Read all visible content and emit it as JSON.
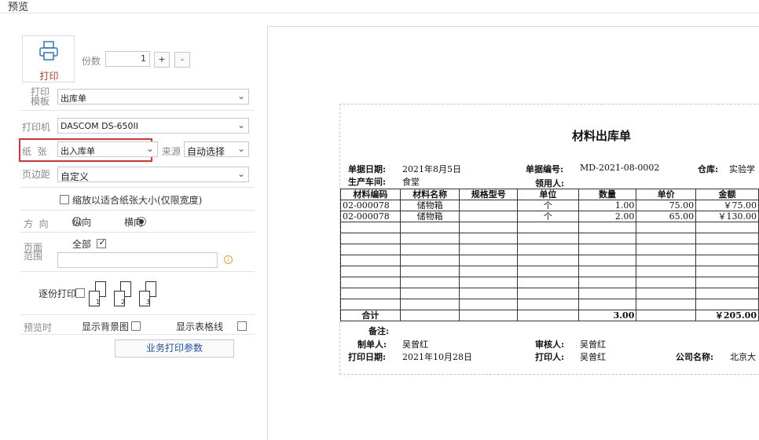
{
  "window": {
    "title": "预览"
  },
  "print_button": {
    "label": "打印",
    "icon": "printer-icon"
  },
  "copies": {
    "label": "份数",
    "value": "1",
    "plus": "+",
    "minus": "-"
  },
  "template": {
    "label_line1": "打印",
    "label_line2": "模板",
    "value": "出库单"
  },
  "printer": {
    "label": "打印机",
    "value": "DASCOM DS-650II"
  },
  "paper": {
    "label": "纸  张",
    "value": "出入库单",
    "source_label": "来源",
    "source_value": "自动选择"
  },
  "margin": {
    "label": "页边距",
    "value": "自定义"
  },
  "scale_option": {
    "label": "缩放以适合纸张大小(仅限宽度)",
    "checked": false
  },
  "orientation": {
    "label": "方  向",
    "portrait": "纵向",
    "landscape": "横向",
    "selected": "landscape"
  },
  "page_range": {
    "label_line1": "页面",
    "label_line2": "范围",
    "all_label": "全部",
    "all_checked": true,
    "value": "",
    "info_icon": "info-icon"
  },
  "collate": {
    "label": "逐份打印",
    "checked": false,
    "pages": [
      "1",
      "2",
      "3"
    ]
  },
  "preview_options": {
    "label": "预览时",
    "show_bg": "显示背景图",
    "show_grid": "显示表格线"
  },
  "business_params_button": {
    "label": "业务打印参数"
  },
  "document": {
    "title": "材料出库单",
    "header": {
      "date_label": "单据日期:",
      "date_value": "2021年8月5日",
      "no_label": "单据编号:",
      "no_value": "MD-2021-08-0002",
      "warehouse_label": "仓库:",
      "warehouse_value": "实验学",
      "workshop_label": "生产车间:",
      "workshop_value": "食堂",
      "receiver_label": "领用人:",
      "receiver_value": ""
    },
    "columns": [
      "材料编码",
      "材料名称",
      "规格型号",
      "单位",
      "数量",
      "单价",
      "金额"
    ],
    "rows": [
      [
        "02-000078",
        "储物箱",
        "",
        "个",
        "1.00",
        "75.00",
        "￥75.00"
      ],
      [
        "02-000078",
        "储物箱",
        "",
        "个",
        "2.00",
        "65.00",
        "￥130.00"
      ]
    ],
    "total": {
      "label": "合计",
      "qty": "3.00",
      "amount": "￥205.00"
    },
    "footer": {
      "remark_label": "备注:",
      "maker_label": "制单人:",
      "maker_value": "吴曾红",
      "auditor_label": "审核人:",
      "auditor_value": "吴曾红",
      "print_date_label": "打印日期:",
      "print_date_value": "2021年10月28日",
      "printer_label": "打印人:",
      "printer_value": "吴曾红",
      "company_label": "公司名称:",
      "company_value": "北京大"
    }
  },
  "colors": {
    "highlight_border": "#e03030",
    "print_label": "#c0392b",
    "link_blue": "#1f4fa8"
  }
}
